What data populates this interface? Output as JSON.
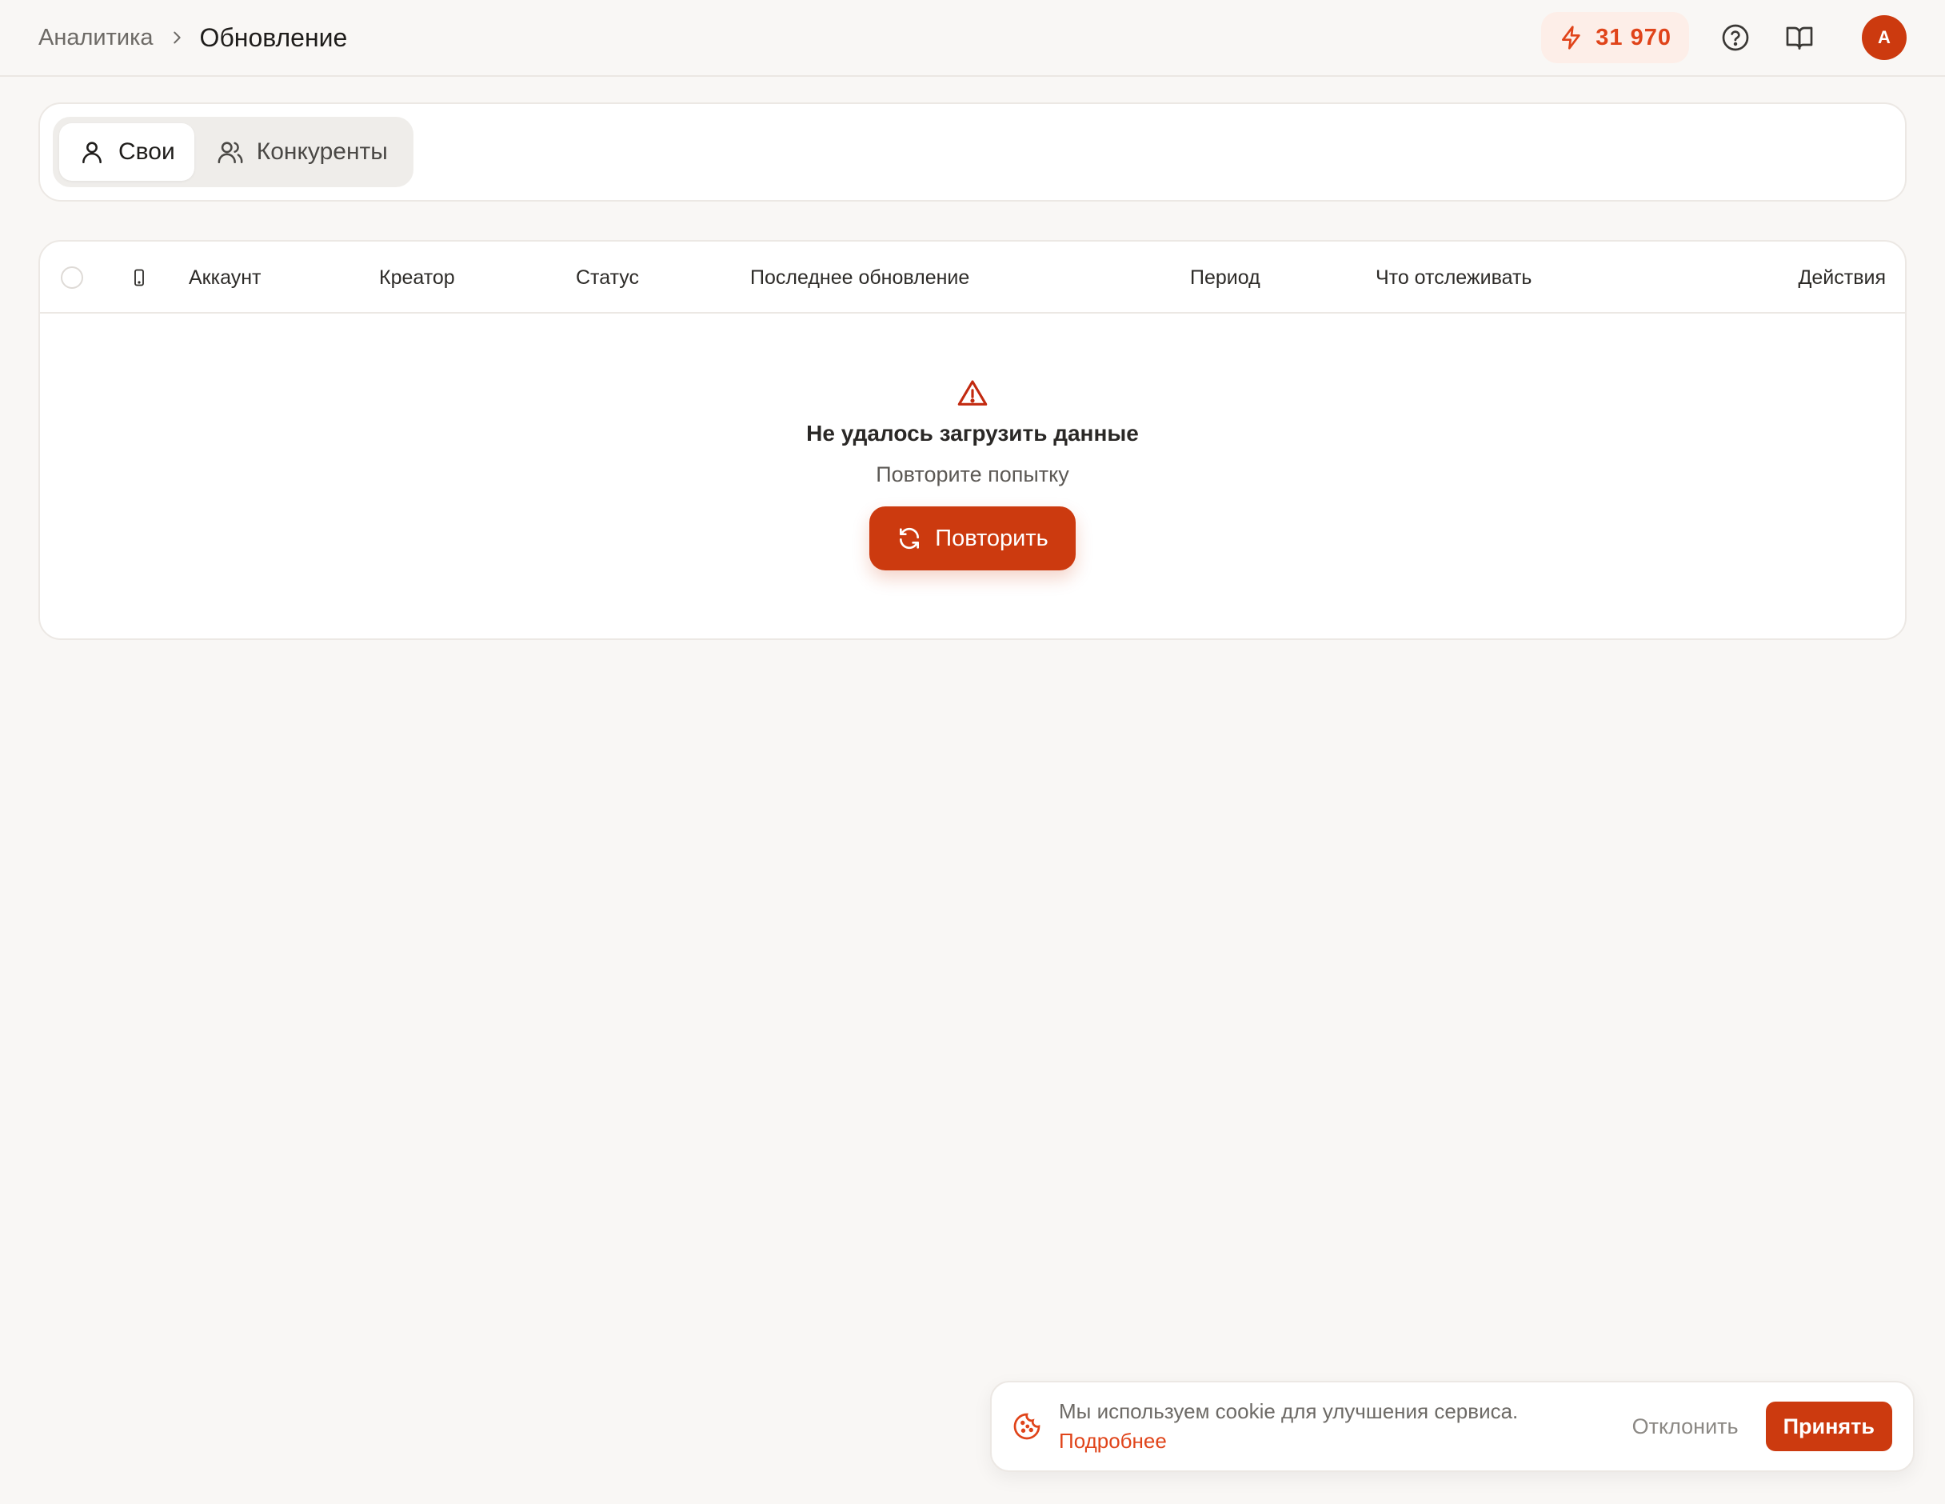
{
  "header": {
    "breadcrumb_parent": "Аналитика",
    "breadcrumb_current": "Обновление",
    "credits": "31 970",
    "avatar_initial": "A"
  },
  "tabs": {
    "own": "Свои",
    "competitors": "Конкуренты"
  },
  "table": {
    "columns": {
      "account": "Аккаунт",
      "creator": "Креатор",
      "status": "Статус",
      "last_update": "Последнее обновление",
      "period": "Период",
      "track": "Что отслеживать",
      "actions": "Действия"
    }
  },
  "error_state": {
    "title": "Не удалось загрузить данные",
    "subtitle": "Повторите попытку",
    "retry_label": "Повторить"
  },
  "cookie_banner": {
    "message": "Мы используем cookie для улучшения сервиса.",
    "link": "Подробнее",
    "decline": "Отклонить",
    "accept": "Принять"
  },
  "colors": {
    "accent": "#cc3a0f",
    "accent_text": "#e0441a",
    "background": "#f9f7f5"
  }
}
